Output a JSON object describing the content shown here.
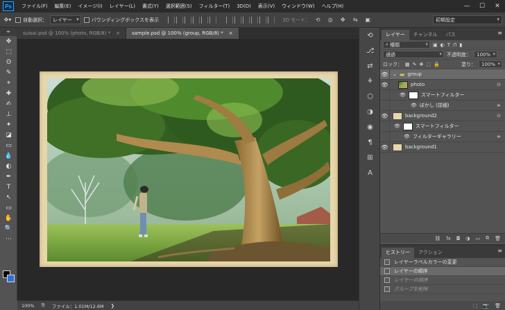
{
  "app": {
    "logo": "Ps"
  },
  "menu": [
    "ファイル(F)",
    "編集(E)",
    "イメージ(I)",
    "レイヤー(L)",
    "書式(Y)",
    "選択範囲(S)",
    "フィルター(T)",
    "3D(D)",
    "表示(V)",
    "ウィンドウ(W)",
    "ヘルプ(H)"
  ],
  "window_controls": {
    "minimize": "—",
    "maximize": "☐",
    "close": "✕"
  },
  "options": {
    "auto_select_label": "自動選択：",
    "auto_select_value": "レイヤー",
    "bounding_box_label": "バウンディングボックスを表示",
    "mode_3d_label": "3D モード：",
    "workspace": "初期設定"
  },
  "tabs": [
    {
      "label": "suisai.psd @ 100% (photo, RGB/8) *",
      "close": "×"
    },
    {
      "label": "sample.psd @ 100% (group, RGB/8) *",
      "close": "×"
    }
  ],
  "tools_header": "◂▸",
  "tools": [
    "✥",
    "⬚",
    "ʘ",
    "✎",
    "⌖",
    "✚",
    "✍",
    "⊥",
    "✦",
    "◪",
    "▭",
    "💧",
    "◐",
    "✒",
    "T",
    "↖",
    "▭",
    "✋",
    "🔍",
    "⋯"
  ],
  "status": {
    "zoom": "100%",
    "file_info": "ファイル：1.01M/12.6M",
    "arrow": "❯"
  },
  "strip_icons": [
    "⟲",
    "⎇",
    "⇄",
    "⚘",
    "⬡",
    "◑",
    "◉",
    "¶",
    "⊞",
    "A"
  ],
  "layers_panel": {
    "tabs": [
      "レイヤー",
      "チャンネル",
      "パス"
    ],
    "menu_icon": "≡",
    "kind_filter": "種類",
    "filter_icons": [
      "▣",
      "◐",
      "T",
      "⊓",
      "▮"
    ],
    "blend_mode": "通過",
    "opacity_label": "不透明度：",
    "opacity": "100%",
    "lock_label": "ロック：",
    "fill_label": "塗り：",
    "fill": "100%",
    "layers": [
      {
        "name": "group",
        "type": "folder",
        "indent": 0,
        "eye": "👁",
        "arrow": "⌄",
        "icon": "▬",
        "selected": true
      },
      {
        "name": "photo",
        "type": "photo",
        "indent": 1,
        "eye": "👁",
        "end": "⊙"
      },
      {
        "name": "スマートフィルター",
        "type": "white",
        "indent": 2,
        "eye": "👁"
      },
      {
        "name": "ぼかし (詳細)",
        "type": "none",
        "indent": 3,
        "eye": "👁",
        "end": "≑"
      },
      {
        "name": "background2",
        "type": "photo",
        "indent": 0,
        "eye": "👁",
        "end": "⊙"
      },
      {
        "name": "スマートフィルター",
        "type": "white",
        "indent": 1,
        "eye": "👁"
      },
      {
        "name": "フィルターギャラリー",
        "type": "none",
        "indent": 2,
        "eye": "👁",
        "end": "≑"
      },
      {
        "name": "background1",
        "type": "frame",
        "indent": 0,
        "eye": "👁"
      }
    ],
    "footer_icons": [
      "⛓",
      "fx",
      "◘",
      "◑",
      "▭",
      "⧉",
      "🗑"
    ]
  },
  "history_panel": {
    "tabs": [
      "ヒストリー",
      "アクション"
    ],
    "menu_icon": "≡",
    "items": [
      {
        "label": "レイヤーラベルカラーの変更",
        "state": "normal"
      },
      {
        "label": "レイヤーの順序",
        "state": "selected"
      },
      {
        "label": "レイヤーの順序",
        "state": "dim"
      },
      {
        "label": "グループを削除",
        "state": "dim"
      }
    ],
    "footer_icons": [
      "⬚",
      "📷",
      "🗑"
    ]
  }
}
